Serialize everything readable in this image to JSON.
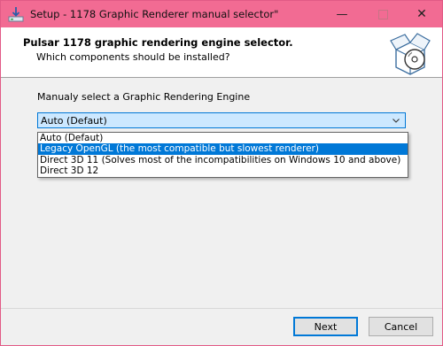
{
  "window": {
    "title": "Setup - 1178 Graphic Renderer manual selector\"",
    "minimize_glyph": "—",
    "close_glyph": "✕"
  },
  "header": {
    "title": "Pulsar 1178 graphic rendering engine selector.",
    "subtitle": "Which components should be installed?"
  },
  "body": {
    "label": "Manualy select a Graphic Rendering Engine",
    "combo": {
      "selected": "Auto (Defaut)"
    },
    "options": [
      {
        "label": "Auto (Defaut)",
        "highlighted": false
      },
      {
        "label": "Legacy OpenGL (the most compatible but slowest renderer)",
        "highlighted": true
      },
      {
        "label": "Direct 3D 11 (Solves most of the incompatibilities on Windows 10 and above)",
        "highlighted": false
      },
      {
        "label": "Direct 3D 12",
        "highlighted": false
      }
    ]
  },
  "footer": {
    "next_label": "Next",
    "cancel_label": "Cancel"
  },
  "colors": {
    "titlebar": "#f26b93",
    "selection": "#0078d7",
    "combo_bg": "#cce8ff"
  },
  "icons": {
    "app": "installer-arrow-icon",
    "header": "package-disc-icon",
    "dropdown": "chevron-down-icon"
  }
}
